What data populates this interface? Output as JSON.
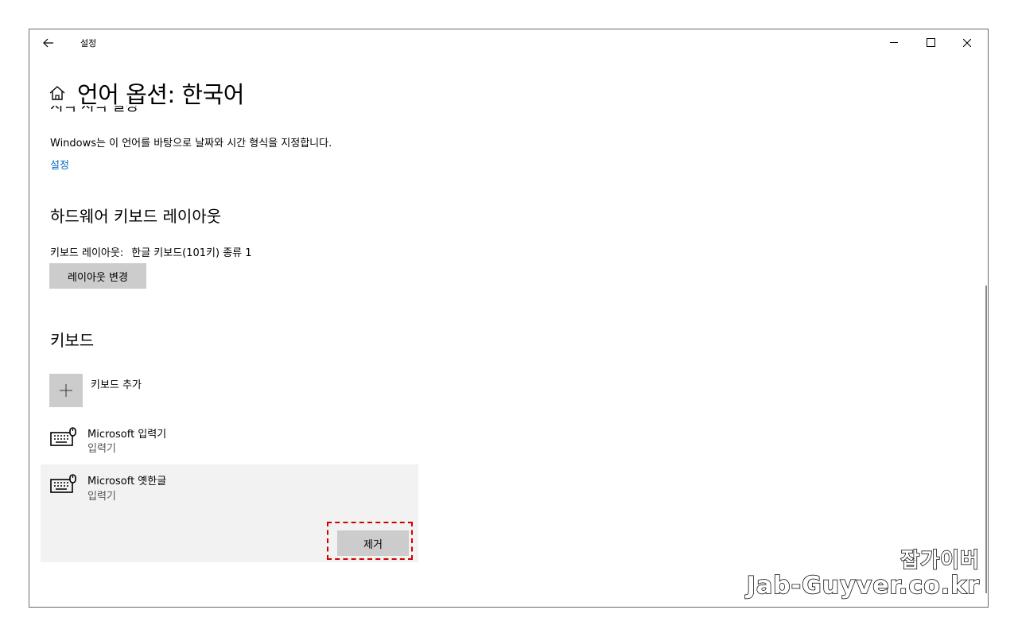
{
  "titlebar": {
    "app_title": "설정",
    "back_icon": "arrow-left-icon",
    "minimize_icon": "minimize-icon",
    "maximize_icon": "maximize-icon",
    "close_icon": "close-icon"
  },
  "header": {
    "home_icon": "home-icon",
    "title": "언어 옵션: 한국어",
    "clipped_heading": "지역 서식 설정"
  },
  "region": {
    "description": "Windows는 이 언어를 바탕으로 날짜와 시간 형식을 지정합니다.",
    "settings_link": "설정"
  },
  "hardware_keyboard": {
    "title": "하드웨어 키보드 레이아웃",
    "layout_label": "키보드 레이아웃:",
    "layout_value": "한글 키보드(101키) 종류 1",
    "change_button": "레이아웃 변경"
  },
  "keyboards": {
    "title": "키보드",
    "add_label": "키보드 추가",
    "add_icon": "plus-icon",
    "items": [
      {
        "name": "Microsoft 입력기",
        "subtitle": "입력기",
        "icon": "keyboard-icon"
      },
      {
        "name": "Microsoft 옛한글",
        "subtitle": "입력기",
        "icon": "keyboard-icon",
        "selected": true
      }
    ],
    "remove_button": "제거"
  },
  "watermark": {
    "line1": "잡가이버",
    "line2": "Jab-Guyver.co.kr"
  },
  "colors": {
    "link": "#0067c0",
    "button_bg": "#cccccc",
    "selected_bg": "#f2f2f2",
    "highlight": "#d10000"
  }
}
